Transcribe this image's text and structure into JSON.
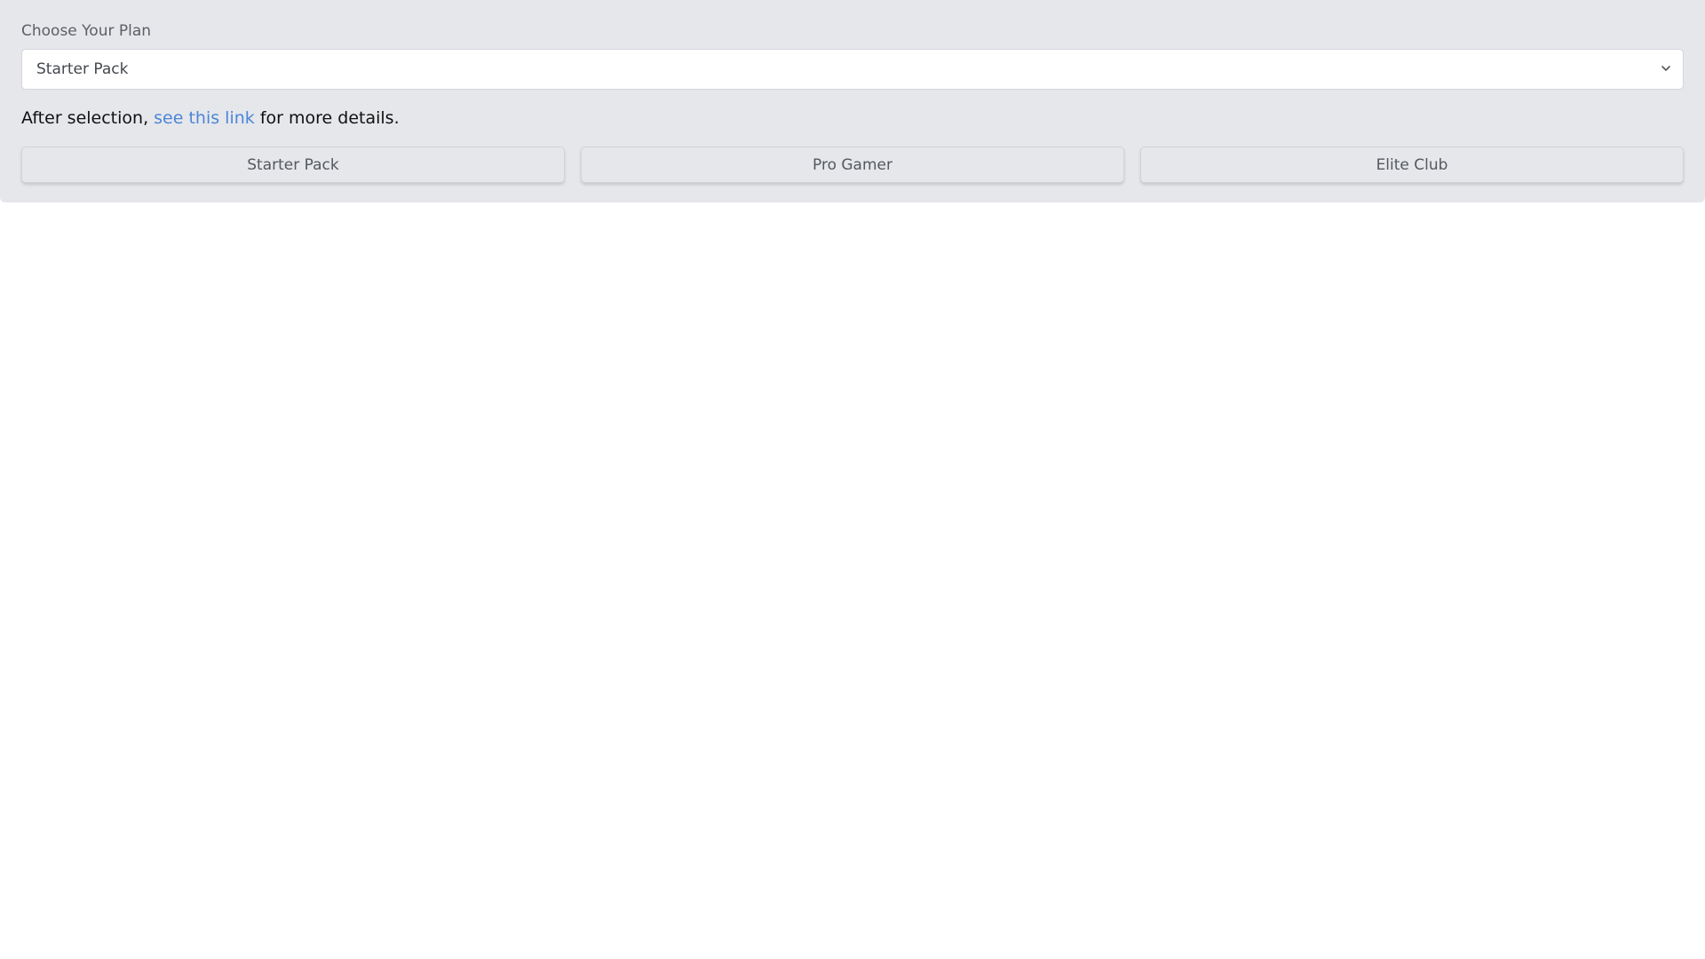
{
  "plan_selector": {
    "label": "Choose Your Plan",
    "selected_value": "Starter Pack",
    "chevron_icon": "chevron-down-icon"
  },
  "helper": {
    "prefix": "After selection,",
    "link_text": "see this link",
    "suffix": "for more details.",
    "link_color": "#4a86d8"
  },
  "plan_buttons": [
    {
      "label": "Starter Pack"
    },
    {
      "label": "Pro Gamer"
    },
    {
      "label": "Elite Club"
    }
  ],
  "colors": {
    "panel_background": "#e6e7eb",
    "page_background": "#ffffff"
  }
}
